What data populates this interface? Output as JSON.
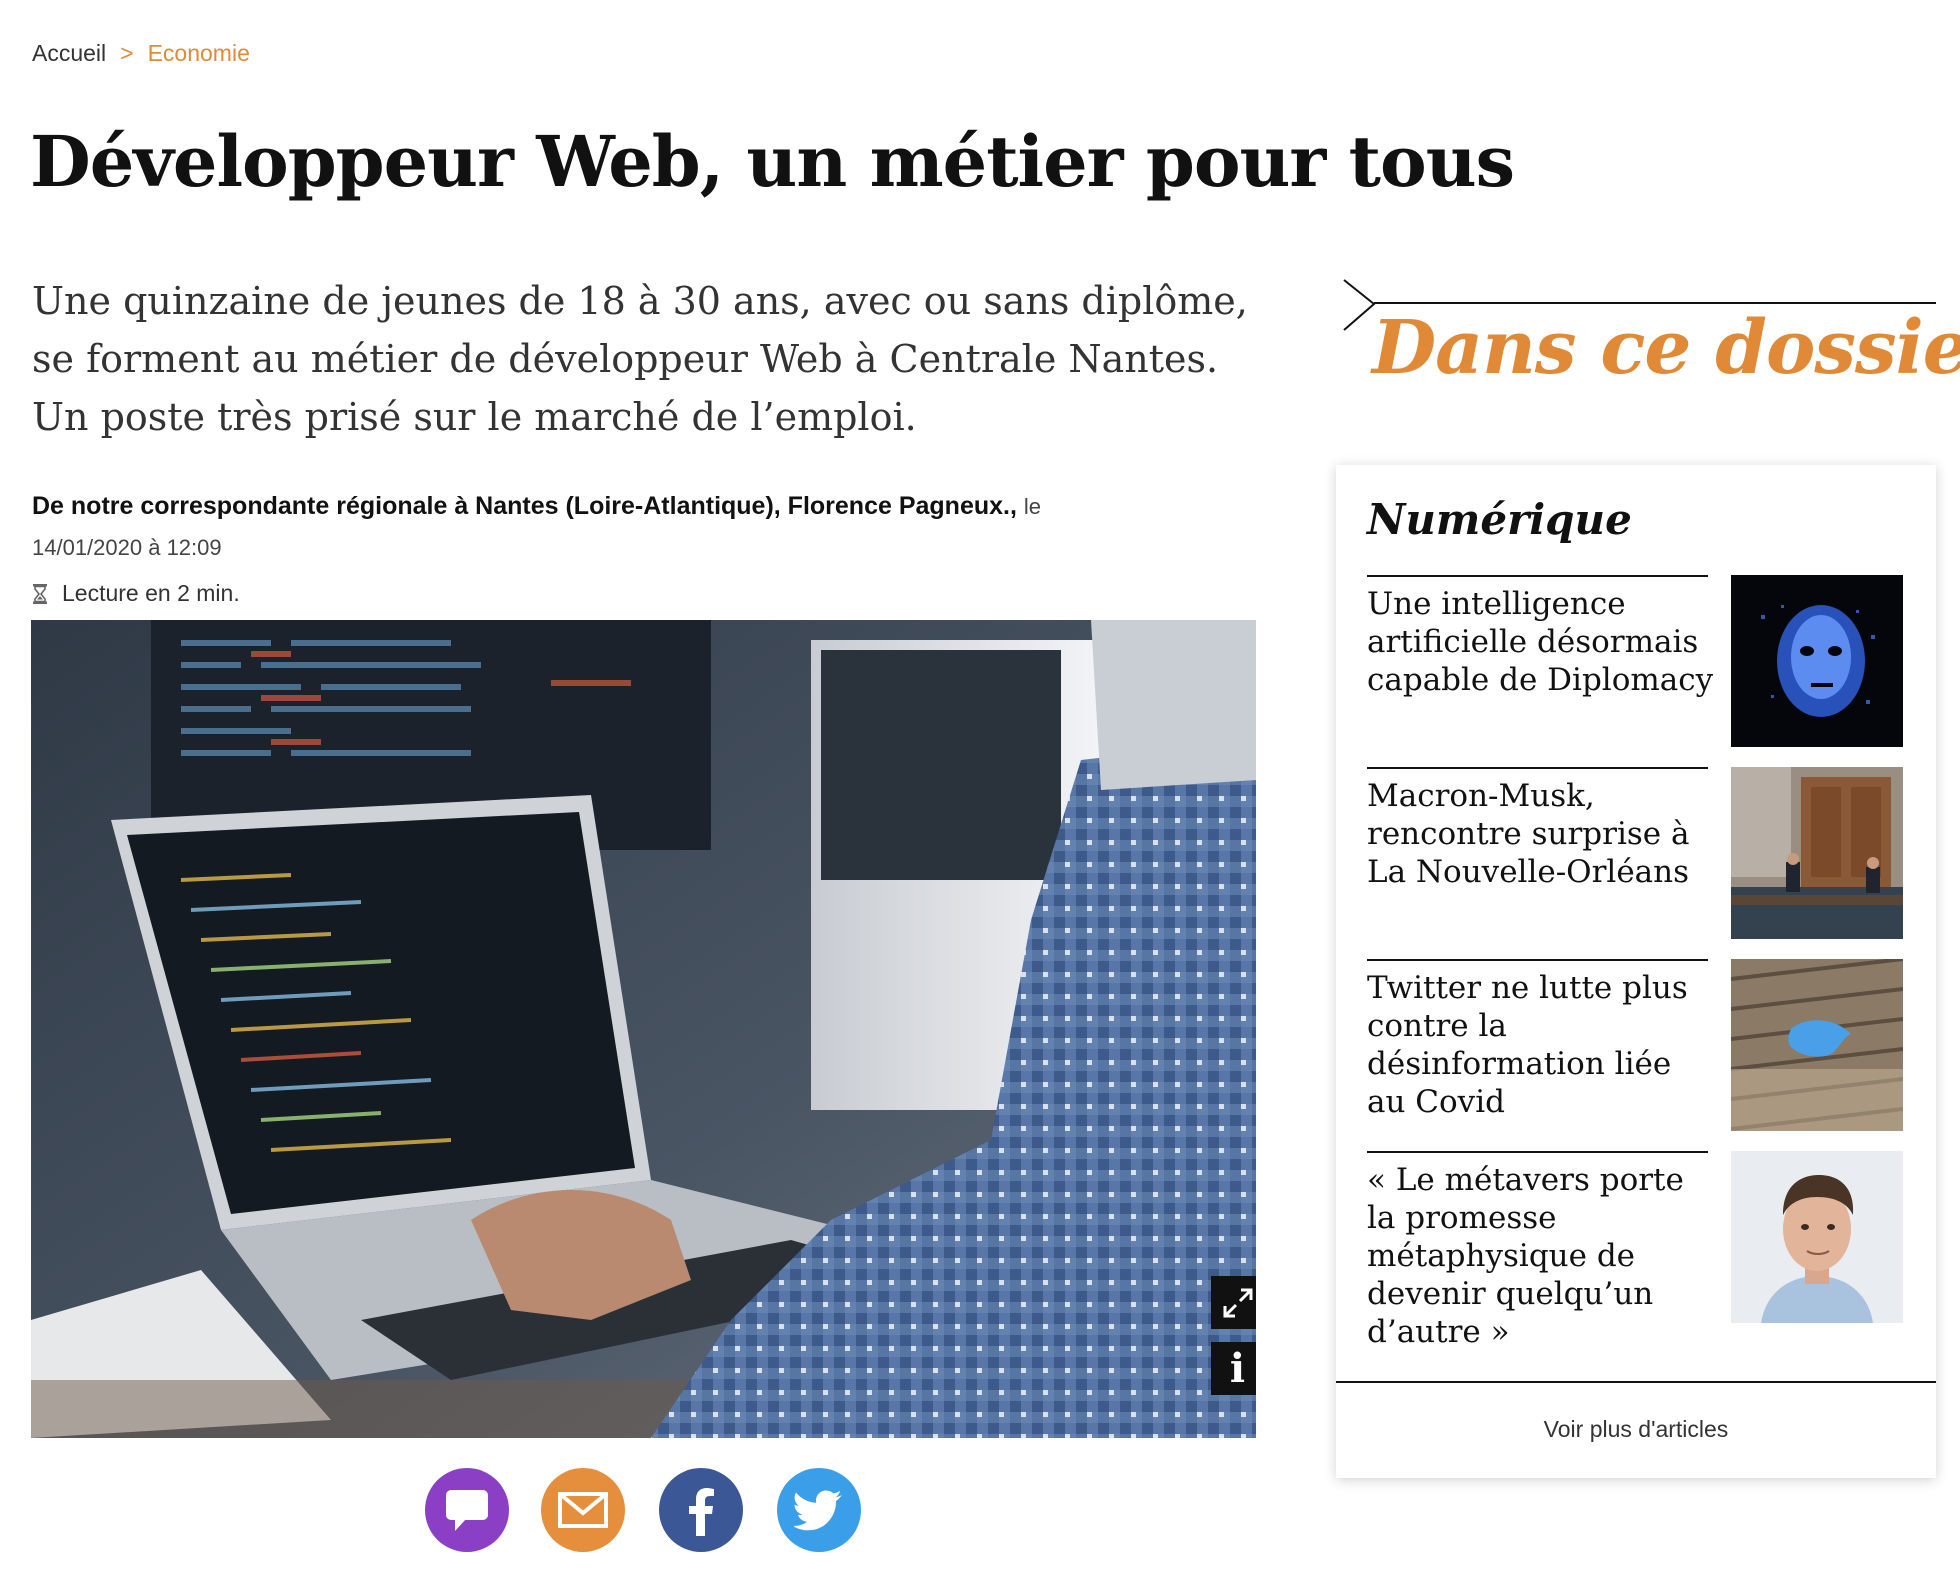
{
  "breadcrumb": {
    "home": "Accueil",
    "separator": ">",
    "current": "Economie"
  },
  "article": {
    "title": "Développeur Web, un métier pour tous",
    "lead": "Une quinzaine de jeunes de 18 à 30 ans, avec ou sans diplôme, se forment au métier de développeur Web à Centrale Nantes. Un poste très prisé sur le marché de l’emploi.",
    "author": "De notre correspondante régionale à Nantes (Loire-Atlantique), Florence Pagneux.,",
    "date_prefix": "le",
    "date": "14/01/2020 à 12:09",
    "reading_time": "Lecture en 2 min.",
    "image_buttons": {
      "expand": "expand-icon",
      "info": "i"
    }
  },
  "share": [
    {
      "name": "comment",
      "color": "#8a3fc4",
      "icon": "comment-icon"
    },
    {
      "name": "email",
      "color": "#e58e3b",
      "icon": "envelope-icon"
    },
    {
      "name": "facebook",
      "color": "#3b5796",
      "icon": "facebook-icon"
    },
    {
      "name": "twitter",
      "color": "#3a9ee8",
      "icon": "twitter-icon"
    }
  ],
  "sidebar": {
    "heading": "Dans ce dossier",
    "accent_color": "#e08a38",
    "section": "Numérique",
    "items": [
      {
        "title": "Une intelligence artificielle désormais capable de Diplomacy"
      },
      {
        "title": "Macron-Musk, rencontre surprise à La Nouvelle-Orléans"
      },
      {
        "title": "Twitter ne lutte plus contre la désinformation liée au Covid"
      },
      {
        "title": "« Le métavers porte la promesse métaphysique de devenir quelqu’un d’autre »"
      }
    ],
    "more_label": "Voir plus d'articles"
  }
}
